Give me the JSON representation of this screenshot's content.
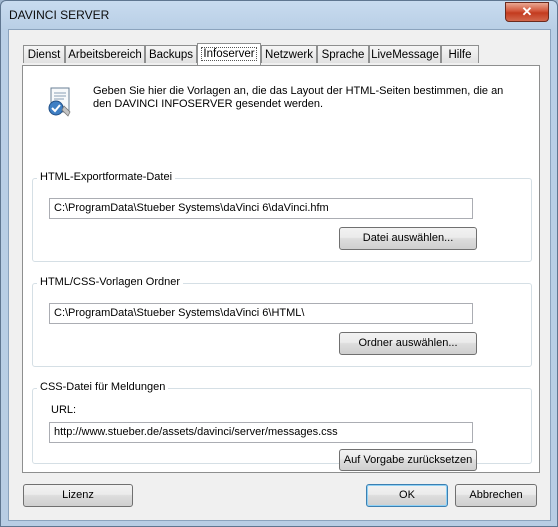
{
  "window": {
    "title": "DAVINCI SERVER",
    "close_glyph": "✕"
  },
  "tabs": [
    {
      "label": "Dienst"
    },
    {
      "label": "Arbeitsbereich"
    },
    {
      "label": "Backups"
    },
    {
      "label": "Infoserver",
      "active": true
    },
    {
      "label": "Netzwerk"
    },
    {
      "label": "Sprache"
    },
    {
      "label": "LiveMessage"
    },
    {
      "label": "Hilfe"
    }
  ],
  "infoserver": {
    "icon": "document-check-icon",
    "intro": "Geben Sie hier die Vorlagen an, die das Layout der HTML-Seiten bestimmen, die an den DAVINCI INFOSERVER gesendet werden.",
    "export_group": {
      "label": "HTML-Exportformate-Datei",
      "path": "C:\\ProgramData\\Stueber Systems\\daVinci 6\\daVinci.hfm",
      "button": "Datei auswählen..."
    },
    "templates_group": {
      "label": "HTML/CSS-Vorlagen Ordner",
      "path": "C:\\ProgramData\\Stueber Systems\\daVinci 6\\HTML\\",
      "button": "Ordner auswählen..."
    },
    "css_group": {
      "label": "CSS-Datei für Meldungen",
      "url_label": "URL:",
      "url": "http://www.stueber.de/assets/davinci/server/messages.css",
      "button": "Auf Vorgabe zurücksetzen"
    }
  },
  "footer": {
    "license_button": "Lizenz",
    "ok_button": "OK",
    "cancel_button": "Abbrechen"
  }
}
